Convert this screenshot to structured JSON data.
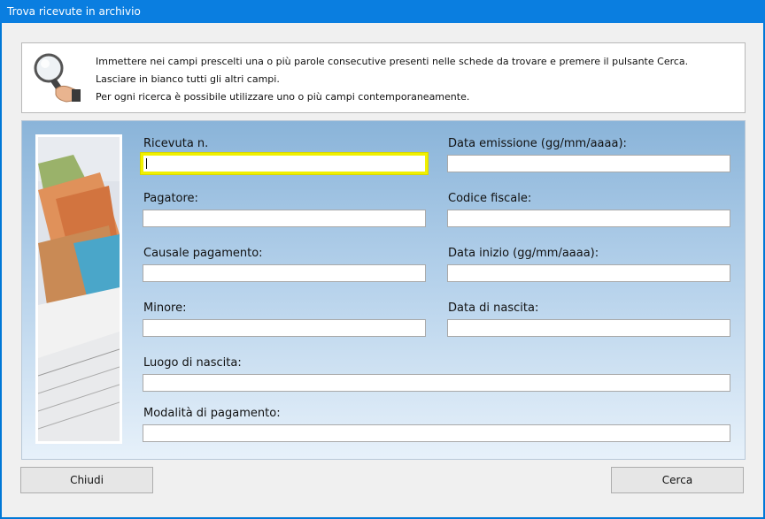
{
  "window": {
    "title": "Trova ricevute in archivio"
  },
  "info": {
    "lines": [
      "Immettere nei campi prescelti una o più parole consecutive presenti nelle schede da trovare e premere il pulsante Cerca.",
      "Lasciare in bianco tutti gli altri campi.",
      "Per ogni ricerca è possibile utilizzare uno o più campi contemporaneamente."
    ]
  },
  "form": {
    "ricevuta_label": "Ricevuta n.",
    "data_emissione_label": "Data emissione (gg/mm/aaaa):",
    "pagatore_label": "Pagatore:",
    "codice_fiscale_label": "Codice fiscale:",
    "causale_label": "Causale pagamento:",
    "data_inizio_label": "Data inizio (gg/mm/aaaa):",
    "minore_label": "Minore:",
    "data_nascita_label": "Data di nascita:",
    "luogo_nascita_label": "Luogo di nascita:",
    "modalita_label": "Modalità di pagamento:"
  },
  "buttons": {
    "close": "Chiudi",
    "search": "Cerca"
  },
  "colors": {
    "titlebar": "#0a7ee0",
    "focus_border": "#f0f000"
  }
}
